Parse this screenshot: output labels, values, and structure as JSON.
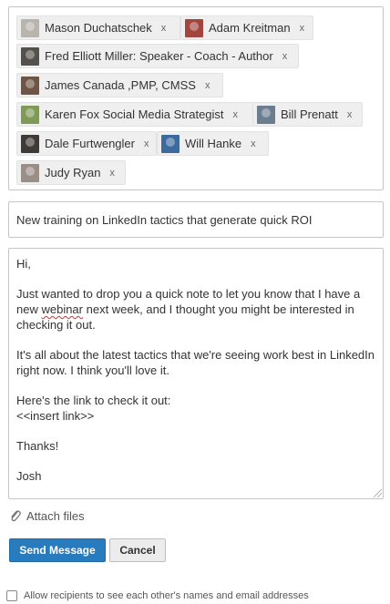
{
  "recipients": [
    {
      "name": "Mason Duchatschek",
      "remove": "x",
      "avatar_color": "#b9b4ad"
    },
    {
      "name": "Adam Kreitman",
      "remove": "x",
      "avatar_color": "#a2453f"
    },
    {
      "name": "Fred Elliott Miller: Speaker - Coach - Author",
      "remove": "x",
      "avatar_color": "#54504c"
    },
    {
      "name": "James Canada ,PMP, CMSS",
      "remove": "x",
      "avatar_color": "#6e5545"
    },
    {
      "name": "Karen Fox Social Media Strategist",
      "remove": "x",
      "avatar_color": "#7f9a57"
    },
    {
      "name": "Bill Prenatt",
      "remove": "x",
      "avatar_color": "#6b7d8f"
    },
    {
      "name": "Dale Furtwengler",
      "remove": "x",
      "avatar_color": "#3f3a37"
    },
    {
      "name": "Will Hanke",
      "remove": "x",
      "avatar_color": "#3d6a9e"
    },
    {
      "name": "Judy Ryan",
      "remove": "x",
      "avatar_color": "#9a8e86"
    }
  ],
  "subject": "New training on LinkedIn tactics that generate quick ROI",
  "message": {
    "greeting": "Hi,",
    "para1_before": "Just wanted to drop you a quick note to let you know that I have a new ",
    "para1_flagged": "webinar",
    "para1_after": " next week, and I thought you might be interested in checking it out.",
    "para2": "It's all about the latest tactics that we're seeing work best in LinkedIn right now.  I think you'll love it.",
    "para3_line1": "Here's the link to check it out:",
    "para3_line2": "<<insert link>>",
    "thanks": "Thanks!",
    "signature": "Josh"
  },
  "attach_label": "Attach files",
  "send_label": "Send Message",
  "cancel_label": "Cancel",
  "consent_label": "Allow recipients to see each other's names and email addresses",
  "colors": {
    "primary": "#287bbc",
    "border": "#c5c5c5",
    "chip": "#efefef"
  }
}
